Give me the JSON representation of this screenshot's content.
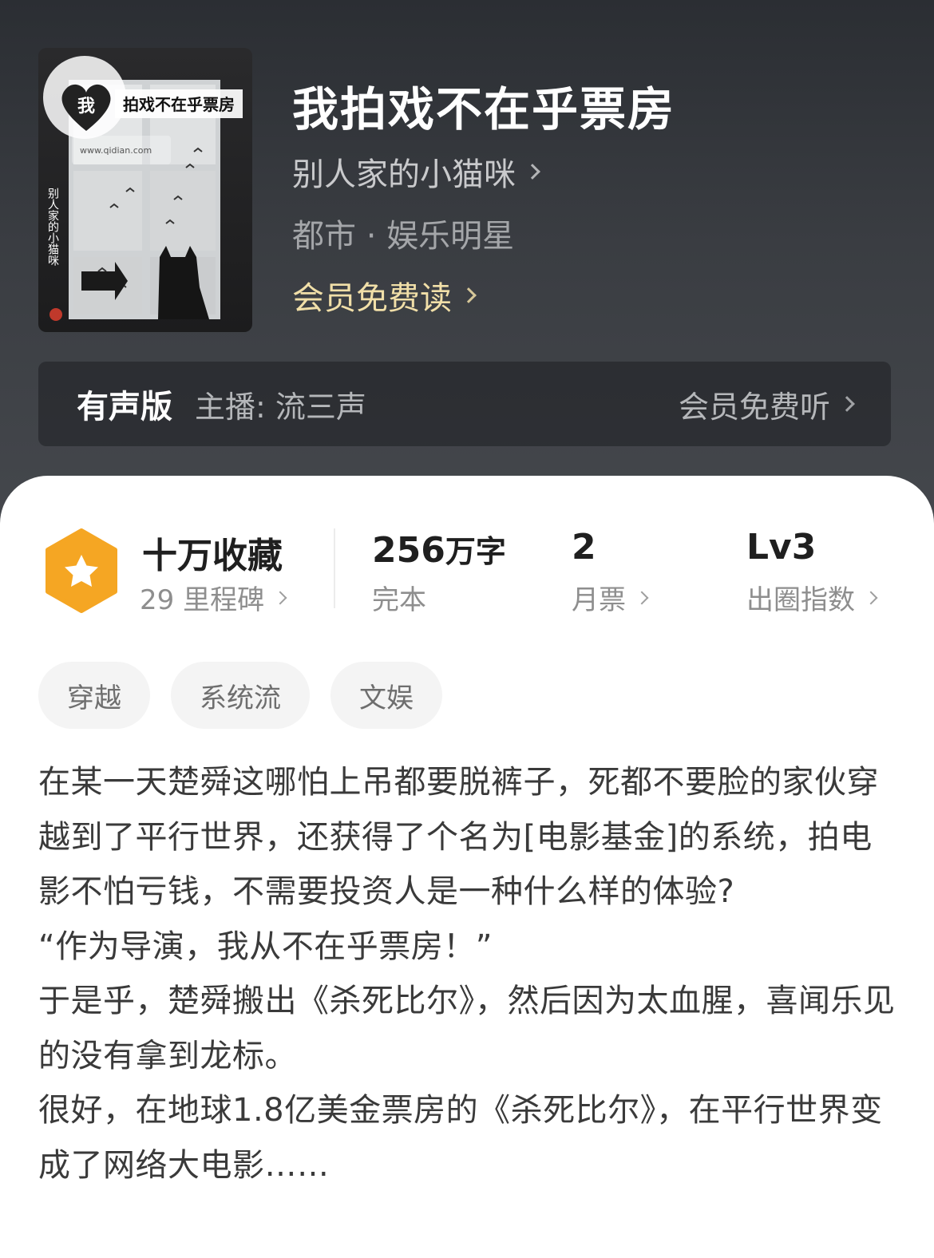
{
  "book": {
    "title": "我拍戏不在乎票房",
    "author": "别人家的小猫咪",
    "genre": "都市 · 娱乐明星",
    "vip_read": "会员免费读",
    "cover_title": "拍戏不在乎票房",
    "cover_heart_char": "我",
    "cover_author_vertical": "别人家的小猫咪",
    "cover_url": "www.qidian.com"
  },
  "audio": {
    "label": "有声版",
    "host": "主播: 流三声",
    "listen": "会员免费听"
  },
  "stats": {
    "collection": {
      "main": "十万收藏",
      "sub": "29 里程碑"
    },
    "words": {
      "number": "256",
      "unit": "万字",
      "sub": "完本"
    },
    "monthly": {
      "main": "2",
      "sub": "月票"
    },
    "level": {
      "main": "Lv3",
      "sub": "出圈指数"
    }
  },
  "tags": [
    "穿越",
    "系统流",
    "文娱"
  ],
  "synopsis": [
    "在某一天楚舜这哪怕上吊都要脱裤子，死都不要脸的家伙穿越到了平行世界，还获得了个名为[电影基金]的系统，拍电影不怕亏钱，不需要投资人是一种什么样的体验?",
    "“作为导演，我从不在乎票房！”",
    "于是乎，楚舜搬出《杀死比尔》，然后因为太血腥，喜闻乐见的没有拿到龙标。",
    "很好，在地球1.8亿美金票房的《杀死比尔》，在平行世界变成了网络大电影……"
  ],
  "colors": {
    "hero_bg": "#3a3d42",
    "vip_gold": "#f1dfa8",
    "badge_orange": "#f5a623"
  },
  "icons": {
    "badge": "star-hexagon-icon",
    "chevron": "chevron-right-icon"
  }
}
